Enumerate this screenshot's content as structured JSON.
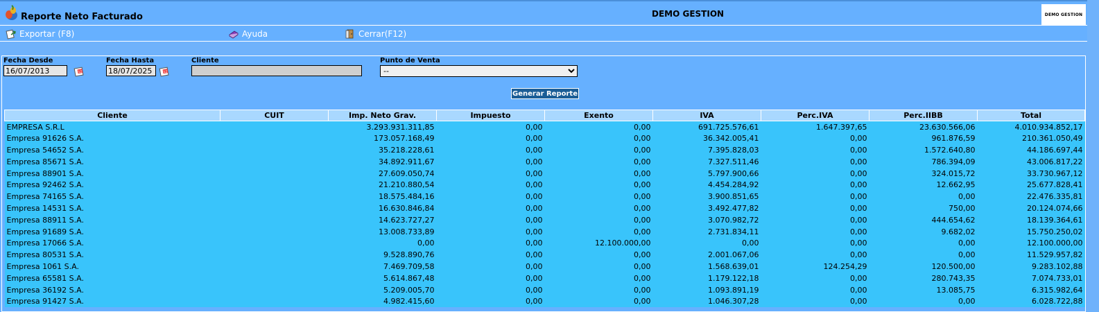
{
  "header": {
    "title": "Reporte Neto Facturado",
    "company": "DEMO GESTION",
    "brand_text": "DEMO GESTION"
  },
  "toolbar": {
    "export_label": "Exportar (F8)",
    "help_label": "Ayuda",
    "close_label": "Cerrar(F12)"
  },
  "filters": {
    "date_from_label": "Fecha Desde",
    "date_from_value": "16/07/2013",
    "date_to_label": "Fecha Hasta",
    "date_to_value": "18/07/2025",
    "client_label": "Cliente",
    "client_value": "",
    "pos_label": "Punto de Venta",
    "pos_selected": "--",
    "generate_label": "Generar Reporte"
  },
  "table": {
    "columns": [
      "Cliente",
      "CUIT",
      "Imp. Neto Grav.",
      "Impuesto",
      "Exento",
      "IVA",
      "Perc.IVA",
      "Perc.IIBB",
      "Total"
    ],
    "rows": [
      [
        "EMPRESA S.R.L",
        "",
        "3.293.931.311,85",
        "0,00",
        "0,00",
        "691.725.576,61",
        "1.647.397,65",
        "23.630.566,06",
        "4.010.934.852,17"
      ],
      [
        "Empresa 91626 S.A.",
        "",
        "173.057.168,49",
        "0,00",
        "0,00",
        "36.342.005,41",
        "0,00",
        "961.876,59",
        "210.361.050,49"
      ],
      [
        "Empresa 54652 S.A.",
        "",
        "35.218.228,61",
        "0,00",
        "0,00",
        "7.395.828,03",
        "0,00",
        "1.572.640,80",
        "44.186.697,44"
      ],
      [
        "Empresa 85671 S.A.",
        "",
        "34.892.911,67",
        "0,00",
        "0,00",
        "7.327.511,46",
        "0,00",
        "786.394,09",
        "43.006.817,22"
      ],
      [
        "Empresa 88901 S.A.",
        "",
        "27.609.050,74",
        "0,00",
        "0,00",
        "5.797.900,66",
        "0,00",
        "324.015,72",
        "33.730.967,12"
      ],
      [
        "Empresa 92462 S.A.",
        "",
        "21.210.880,54",
        "0,00",
        "0,00",
        "4.454.284,92",
        "0,00",
        "12.662,95",
        "25.677.828,41"
      ],
      [
        "Empresa 74165 S.A.",
        "",
        "18.575.484,16",
        "0,00",
        "0,00",
        "3.900.851,65",
        "0,00",
        "0,00",
        "22.476.335,81"
      ],
      [
        "Empresa 14531 S.A.",
        "",
        "16.630.846,84",
        "0,00",
        "0,00",
        "3.492.477,82",
        "0,00",
        "750,00",
        "20.124.074,66"
      ],
      [
        "Empresa 88911 S.A.",
        "",
        "14.623.727,27",
        "0,00",
        "0,00",
        "3.070.982,72",
        "0,00",
        "444.654,62",
        "18.139.364,61"
      ],
      [
        "Empresa 91689 S.A.",
        "",
        "13.008.733,89",
        "0,00",
        "0,00",
        "2.731.834,11",
        "0,00",
        "9.682,02",
        "15.750.250,02"
      ],
      [
        "Empresa 17066 S.A.",
        "",
        "0,00",
        "0,00",
        "12.100.000,00",
        "0,00",
        "0,00",
        "0,00",
        "12.100.000,00"
      ],
      [
        "Empresa 80531 S.A.",
        "",
        "9.528.890,76",
        "0,00",
        "0,00",
        "2.001.067,06",
        "0,00",
        "0,00",
        "11.529.957,82"
      ],
      [
        "Empresa 1061 S.A.",
        "",
        "7.469.709,58",
        "0,00",
        "0,00",
        "1.568.639,01",
        "124.254,29",
        "120.500,00",
        "9.283.102,88"
      ],
      [
        "Empresa 65581 S.A.",
        "",
        "5.614.867,48",
        "0,00",
        "0,00",
        "1.179.122,18",
        "0,00",
        "280.743,35",
        "7.074.733,01"
      ],
      [
        "Empresa 36192 S.A.",
        "",
        "5.209.005,70",
        "0,00",
        "0,00",
        "1.093.891,19",
        "0,00",
        "13.085,75",
        "6.315.982,64"
      ],
      [
        "Empresa 91427 S.A.",
        "",
        "4.982.415,60",
        "0,00",
        "0,00",
        "1.046.307,28",
        "0,00",
        "0,00",
        "6.028.722,88"
      ]
    ]
  }
}
